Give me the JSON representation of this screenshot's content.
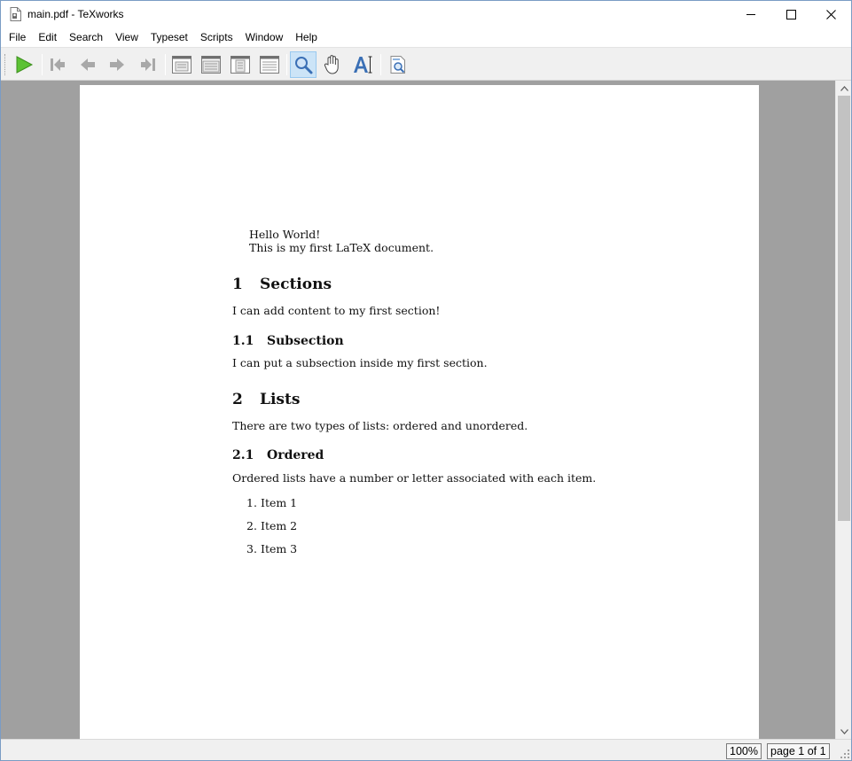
{
  "window": {
    "title": "main.pdf - TeXworks"
  },
  "menu": [
    "File",
    "Edit",
    "Search",
    "View",
    "Typeset",
    "Scripts",
    "Window",
    "Help"
  ],
  "toolbar": {
    "buttons": [
      "typeset-play-icon",
      "first-page-icon",
      "previous-page-icon",
      "next-page-icon",
      "last-page-icon",
      "actual-size-icon",
      "fit-width-icon",
      "fit-page-icon",
      "fit-window-icon",
      "magnify-icon",
      "pan-hand-icon",
      "select-text-icon",
      "goto-source-icon"
    ],
    "active_tool": "magnify-icon",
    "colors": {
      "play": "#4caf2a",
      "active_bg": "#cce4f7",
      "icon_gray": "#9a9a9a",
      "icon_blue": "#3a6fb5"
    }
  },
  "document": {
    "hello": "Hello World!",
    "intro": "This is my first LaTeX document.",
    "sec1_num": "1",
    "sec1_title": "Sections",
    "sec1_text": "I can add content to my first section!",
    "sub11_num": "1.1",
    "sub11_title": "Subsection",
    "sub11_text": "I can put a subsection inside my first section.",
    "sec2_num": "2",
    "sec2_title": "Lists",
    "sec2_text": "There are two types of lists: ordered and unordered.",
    "sub21_num": "2.1",
    "sub21_title": "Ordered",
    "sub21_text": "Ordered lists have a number or letter associated with each item.",
    "items": [
      {
        "num": "1.",
        "text": "Item 1"
      },
      {
        "num": "2.",
        "text": "Item 2"
      },
      {
        "num": "3.",
        "text": "Item 3"
      }
    ]
  },
  "status": {
    "zoom": "100%",
    "page": "page 1 of 1"
  }
}
